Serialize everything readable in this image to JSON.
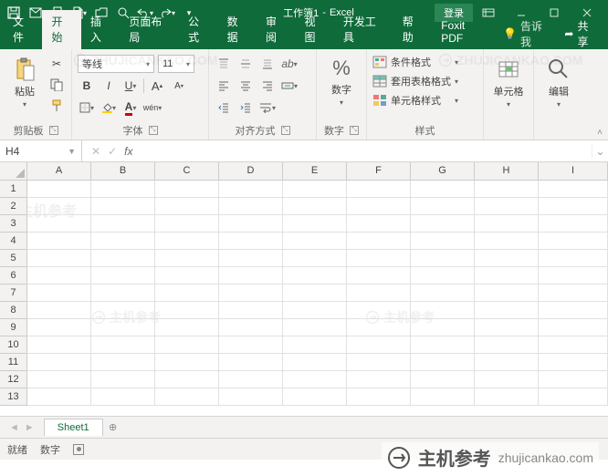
{
  "title": {
    "doc": "工作簿1",
    "app": "Excel",
    "login": "登录"
  },
  "tabs": [
    "文件",
    "开始",
    "插入",
    "页面布局",
    "公式",
    "数据",
    "审阅",
    "视图",
    "开发工具",
    "帮助",
    "Foxit PDF"
  ],
  "active_tab": 1,
  "tell_me": "告诉我",
  "share": "共享",
  "ribbon": {
    "clipboard": {
      "label": "剪贴板",
      "paste": "粘贴"
    },
    "font": {
      "label": "字体",
      "name": "等线",
      "size": "11",
      "bold": "B",
      "italic": "I",
      "underline": "U",
      "phonetic": "wén"
    },
    "align": {
      "label": "对齐方式"
    },
    "number": {
      "label": "数字",
      "btn": "数字",
      "percent": "%"
    },
    "styles": {
      "label": "样式",
      "cond": "条件格式",
      "table": "套用表格格式",
      "cell": "单元格样式"
    },
    "cells": {
      "label": "单元格"
    },
    "editing": {
      "label": "编辑"
    }
  },
  "fx": {
    "ref": "H4",
    "fx_label": "fx"
  },
  "columns": [
    "A",
    "B",
    "C",
    "D",
    "E",
    "F",
    "G",
    "H",
    "I"
  ],
  "row_count": 13,
  "sheet": {
    "name": "Sheet1"
  },
  "status": {
    "ready": "就绪",
    "num": "数字"
  },
  "watermark": {
    "cn": "主机参考",
    "domain": "zhujicankao.com",
    "en": "ZHUJICANKAO.COM"
  }
}
